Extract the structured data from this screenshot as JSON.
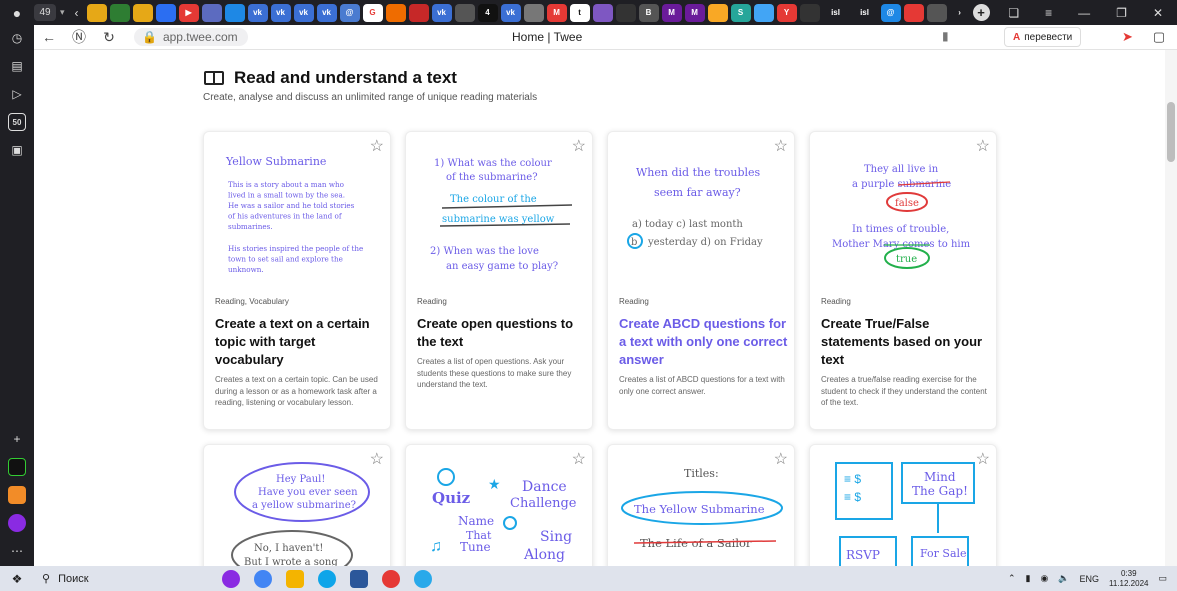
{
  "browser": {
    "tab_count": "49",
    "url": "app.twee.com",
    "page_title": "Home | Twee",
    "translate_label": "перевести",
    "tab_icons": [
      "vk-icon",
      "vk-icon",
      "vk-icon",
      "vk-icon",
      "mail-icon",
      "google-icon",
      "vk-icon",
      "4",
      "vk-icon",
      "t",
      "B",
      "M",
      "M",
      "S",
      "Y",
      "isl",
      "isl"
    ],
    "sidebar_badge": "50"
  },
  "section": {
    "title": "Read and understand a text",
    "subtitle": "Create, analyse and discuss an unlimited range of unique reading materials"
  },
  "cards": [
    {
      "category": "Reading, Vocabulary",
      "title": "Create a text on a certain topic with target vocabulary",
      "description": "Creates a text on a certain topic. Can be used during a lesson or as a homework task after a reading, listening or vocabulary lesson.",
      "illus": {
        "heading": "Yellow Submarine",
        "p1": [
          "This is a story about a man who",
          "lived in a small town by the sea.",
          "He was a sailor and he told stories",
          "of his adventures in the land of",
          "submarines."
        ],
        "p2": [
          "His stories inspired the people of the",
          "town to set sail and explore the",
          "unknown."
        ]
      }
    },
    {
      "category": "Reading",
      "title": "Create open questions to the text",
      "description": "Creates a list of open questions. Ask your students these questions to make sure they understand the text.",
      "illus": {
        "q1": [
          "1) What was the colour",
          "of the submarine?"
        ],
        "a1": [
          "The colour of the",
          "submarine was yellow"
        ],
        "q2": [
          "2) When was the love",
          "an easy game to play?"
        ]
      }
    },
    {
      "category": "Reading",
      "title": "Create ABCD questions for a text with only one correct answer",
      "description": "Creates a list of ABCD questions for a text with only one correct answer.",
      "illus": {
        "q": [
          "When did the troubles",
          "seem far away?"
        ],
        "opt1": "a) today    c) last month",
        "opt2_b": "b",
        "opt2": "yesterday  d) on Friday"
      }
    },
    {
      "category": "Reading",
      "title": "Create True/False statements based on your text",
      "description": "Creates a true/false reading exercise for the student to check if they understand the content of the text.",
      "illus": {
        "s1": [
          "They all live in",
          "a purple submarine"
        ],
        "f": "false",
        "s2": [
          "In times of trouble,",
          "Mother Mary comes to him"
        ],
        "t": "true"
      }
    },
    {
      "illus": {
        "bubble1": [
          "Hey Paul!",
          "Have you ever seen",
          "a yellow submarine?"
        ],
        "bubble2": [
          "No, I haven't!",
          "But I wrote a song"
        ]
      }
    },
    {
      "illus": {
        "words": [
          "Quiz",
          "Dance",
          "Challenge",
          "Name",
          "That",
          "Tune",
          "Sing",
          "Along"
        ]
      }
    },
    {
      "illus": {
        "label": "Titles:",
        "t1": "The Yellow Submarine",
        "t2": "The Life of a Sailor"
      }
    },
    {
      "illus": {
        "mind": [
          "Mind",
          "The Gap!"
        ],
        "rsvp": "RSVP",
        "sale": "For Sale"
      }
    }
  ],
  "taskbar": {
    "search_placeholder": "Поиск",
    "lang": "ENG",
    "time": "0:39",
    "date": "11.12.2024"
  },
  "colors": {
    "accent": "#6b5ce7",
    "blue": "#1aa6e6",
    "green": "#22b04b",
    "red": "#e03a3a"
  }
}
